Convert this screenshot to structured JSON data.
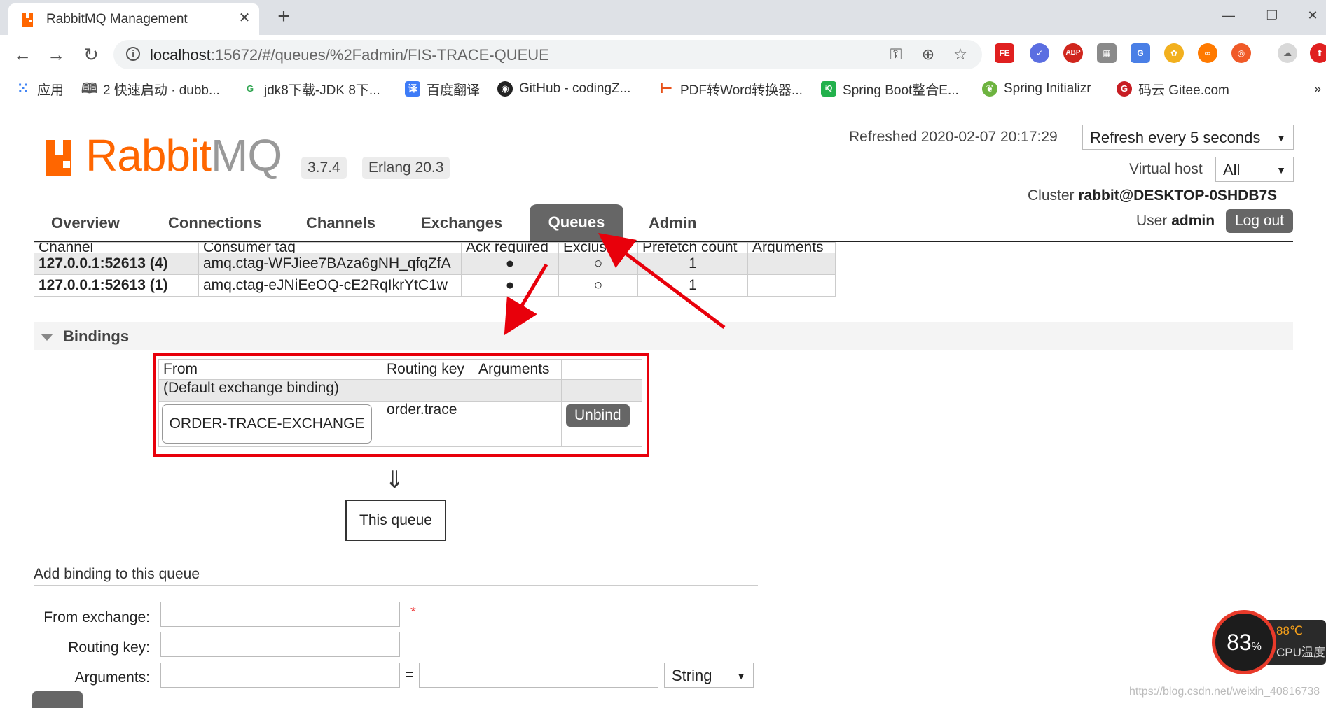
{
  "browser": {
    "tab_title": "RabbitMQ Management",
    "url_host": "localhost",
    "url_rest": ":15672/#/queues/%2Fadmin/FIS-TRACE-QUEUE",
    "bookmarks": [
      {
        "label": "应用",
        "icon": "apps-icon",
        "color": "#4285f4"
      },
      {
        "label": "2 快速启动 · dubb...",
        "icon": "book-icon",
        "color": "#555555"
      },
      {
        "label": "jdk8下载-JDK 8下...",
        "icon": "gplus-icon",
        "color": "#2da44e"
      },
      {
        "label": "百度翻译",
        "icon": "translate-icon",
        "color": "#3d7bf7"
      },
      {
        "label": "GitHub - codingZ...",
        "icon": "github-icon",
        "color": "#222222"
      },
      {
        "label": "PDF转Word转换器...",
        "icon": "pdf-icon",
        "color": "#e8521a"
      },
      {
        "label": "Spring Boot整合E...",
        "icon": "iqiyi-icon",
        "color": "#22b14c"
      },
      {
        "label": "Spring Initializr",
        "icon": "spring-icon",
        "color": "#6db33f"
      },
      {
        "label": "码云 Gitee.com",
        "icon": "gitee-icon",
        "color": "#c71d23"
      }
    ],
    "more": "»"
  },
  "header": {
    "logo_rabbit": "Rabbit",
    "logo_mq": "MQ",
    "version": "3.7.4",
    "erlang": "Erlang 20.3",
    "refreshed_label": "Refreshed 2020-02-07 20:17:29",
    "refresh_select": "Refresh every 5 seconds",
    "vhost_label": "Virtual host",
    "vhost_select": "All",
    "cluster_label": "Cluster",
    "cluster_name": "rabbit@DESKTOP-0SHDB7S",
    "user_label": "User",
    "user_name": "admin",
    "logout": "Log out",
    "brand_color": "#ff6600"
  },
  "nav": {
    "items": [
      "Overview",
      "Connections",
      "Channels",
      "Exchanges",
      "Queues",
      "Admin"
    ],
    "active": "Queues"
  },
  "consumers": {
    "headers": [
      "Channel",
      "Consumer tag",
      "Ack required",
      "Exclusive",
      "Prefetch count",
      "Arguments"
    ],
    "rows": [
      {
        "channel": "127.0.0.1:52613 (4)",
        "tag": "amq.ctag-WFJiee7BAza6gNH_qfqZfA",
        "ack": "●",
        "exclusive": "○",
        "prefetch": "1",
        "args": ""
      },
      {
        "channel": "127.0.0.1:52613 (1)",
        "tag": "amq.ctag-eJNiEeOQ-cE2RqIkrYtC1w",
        "ack": "●",
        "exclusive": "○",
        "prefetch": "1",
        "args": ""
      }
    ]
  },
  "bindings": {
    "section_title": "Bindings",
    "headers": [
      "From",
      "Routing key",
      "Arguments",
      ""
    ],
    "default_row": "(Default exchange binding)",
    "row": {
      "from": "ORDER-TRACE-EXCHANGE",
      "routing_key": "order.trace",
      "arguments": "",
      "action": "Unbind"
    },
    "arrow": "⇓",
    "this_queue": "This queue",
    "highlight_color": "#e8000b"
  },
  "add_binding": {
    "title": "Add binding to this queue",
    "from_label": "From exchange:",
    "routing_label": "Routing key:",
    "args_label": "Arguments:",
    "required_mark": "*",
    "equals": "=",
    "type_select": "String"
  },
  "overlay": {
    "cpu_percent": "83",
    "cpu_percent_unit": "%",
    "cpu_temp": "88℃",
    "cpu_label": "CPU温度",
    "watermark": "https://blog.csdn.net/weixin_40816738"
  }
}
